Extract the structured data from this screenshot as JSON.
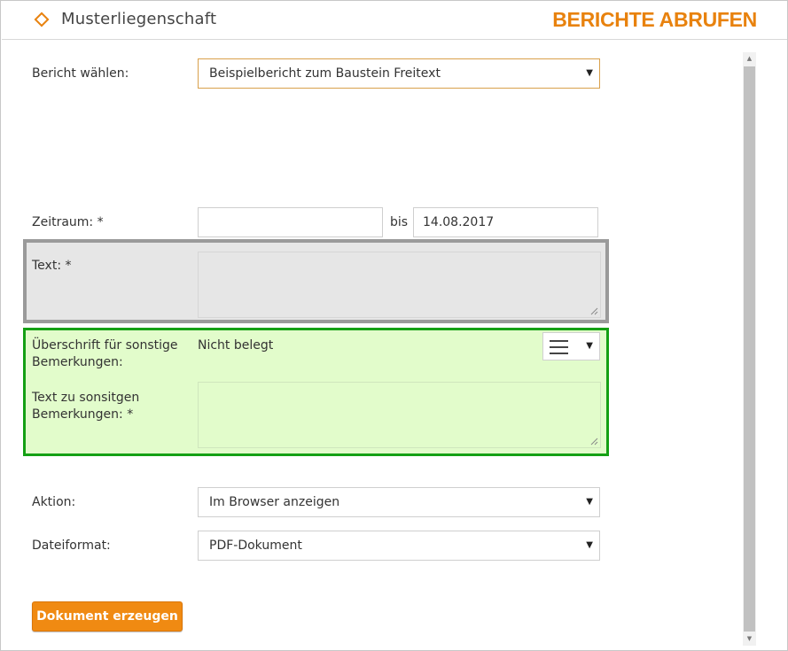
{
  "header": {
    "property_name": "Musterliegenschaft",
    "page_title": "BERICHTE ABRUFEN"
  },
  "form": {
    "report_label": "Bericht wählen:",
    "report_value": "Beispielbericht zum Baustein Freitext",
    "period_label": "Zeitraum: *",
    "period_from": "",
    "period_separator": "bis",
    "period_to": "14.08.2017",
    "text_label": "Text: *",
    "text_value": "",
    "heading_label": "Überschrift für sonstige Bemerkungen:",
    "heading_value": "Nicht belegt",
    "remarks_label": "Text zu sonsitgen Bemerkungen: *",
    "remarks_value": "",
    "action_label": "Aktion:",
    "action_value": "Im Browser anzeigen",
    "format_label": "Dateiformat:",
    "format_value": "PDF-Dokument",
    "submit_label": "Dokument erzeugen"
  },
  "icons": {
    "title_marker": "diamond-icon",
    "menu": "hamburger-icon",
    "dropdown": "caret-down-icon"
  },
  "colors": {
    "accent": "#e8820e",
    "button": "#f08a12",
    "highlight_gray_border": "#9a9a9a",
    "highlight_green_border": "#14a014",
    "highlight_green_bg": "#e2fccb"
  }
}
